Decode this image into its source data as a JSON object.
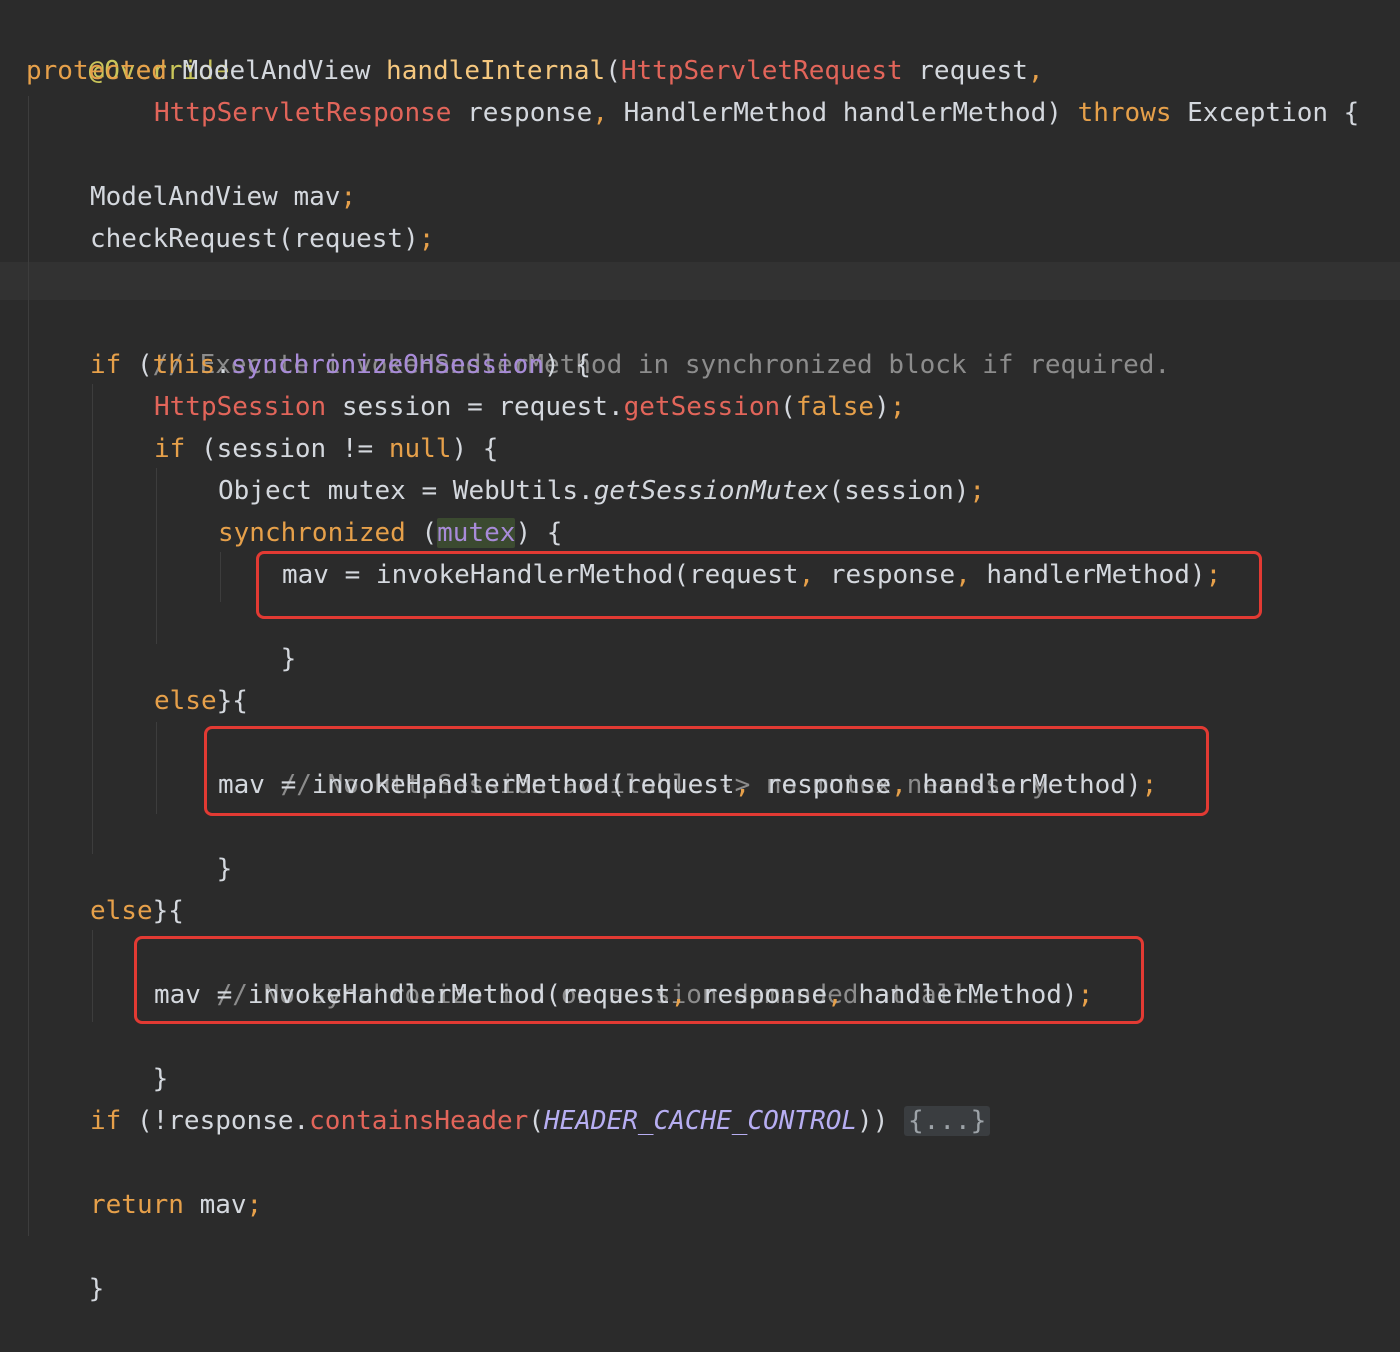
{
  "code": {
    "override": "@Override",
    "protected": "protected",
    "model_and_view": "ModelAndView",
    "handle_internal": "handleInternal",
    "paren_open": "(",
    "http_servlet_request": "HttpServletRequest",
    "request_param": " request",
    "comma": ",",
    "http_servlet_response": "HttpServletResponse",
    "response_param": " response",
    "handler_method_param": " HandlerMethod handlerMethod)",
    "throws": "throws",
    "exception_brace": " Exception {",
    "mav_decl": "ModelAndView mav",
    "semicolon": ";",
    "check_request": "checkRequest(request)",
    "comment_execute": "// Execute invokeHandlerMethod in synchronized block if required.",
    "if": "if",
    "this": "this",
    "dot": ".",
    "sync_on_session": "synchronizeOnSession",
    "close_paren_brace": ") {",
    "open_paren": " (",
    "http_session": "HttpSession",
    "session_assign": " session = request.",
    "get_session": "getSession",
    "false": "false",
    "close_paren": ")",
    "session_not": " (session != ",
    "null": "null",
    "object_mutex": "Object mutex = WebUtils.",
    "get_session_mutex": "getSessionMutex",
    "session_arg": "(session)",
    "synchronized": "synchronized",
    "mutex": "mutex",
    "mav_invoke": "mav = invokeHandlerMethod(request",
    "response_arg": " response",
    "handler_arg": " handlerMethod)",
    "close_brace": "}",
    "else": "else",
    "open_brace": " {",
    "comment_no_session": "// No HttpSession available -> no mutex necessary",
    "comment_no_sync": "// No synchronization on session demanded at all...",
    "not_response": " (!response.",
    "contains_header": "containsHeader",
    "header_cache_control": "HEADER_CACHE_CONTROL",
    "double_close": "))",
    "folded": "{...}",
    "return": "return",
    "mav_return": " mav"
  },
  "colors": {
    "background": "#2b2b2b",
    "keyword": "#e6a04a",
    "annotation": "#c9c55a",
    "method_decl": "#f5c77e",
    "type_red": "#e2655a",
    "field": "#a88bd8",
    "comment": "#8c8c8c",
    "highlight_box": "#e23a33"
  }
}
